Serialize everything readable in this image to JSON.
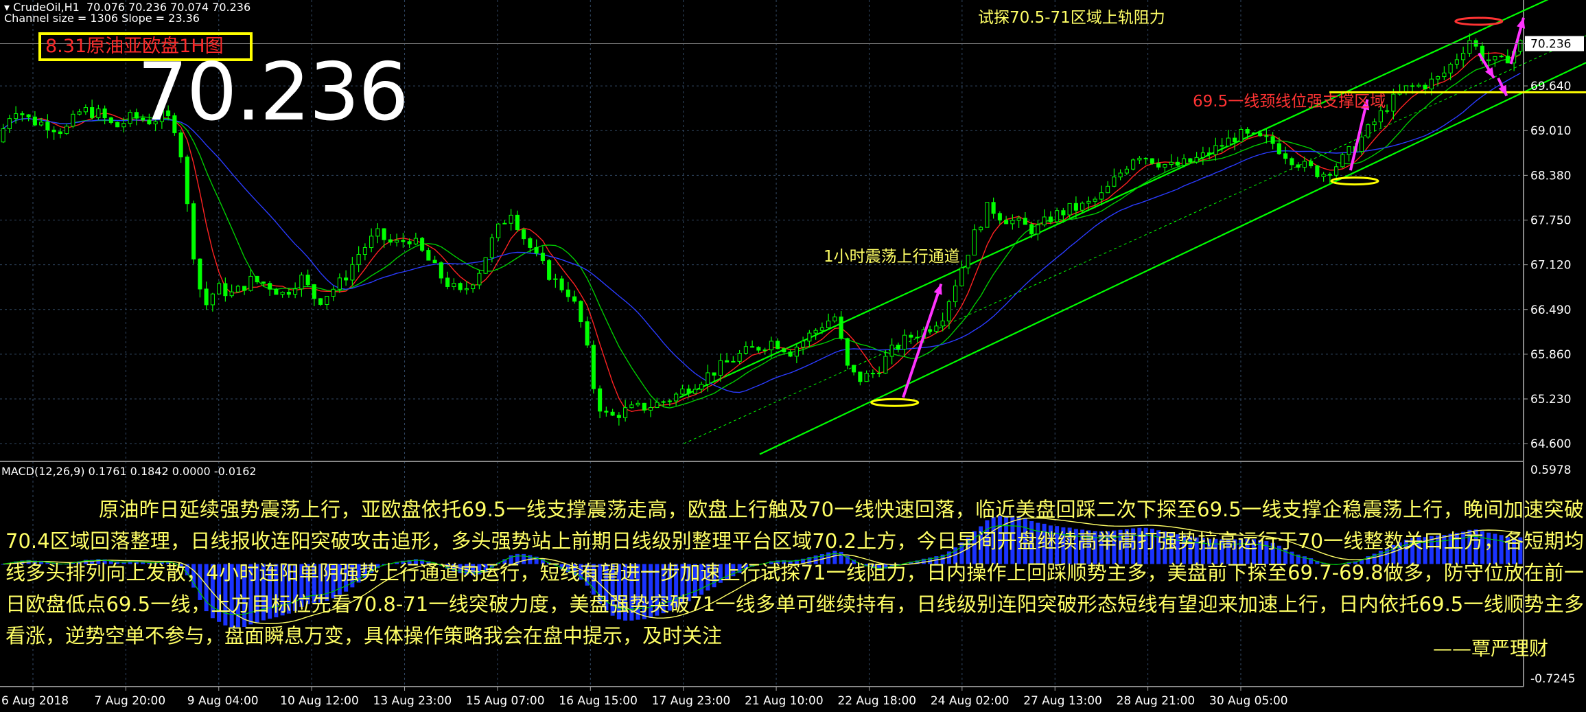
{
  "header": {
    "symbol_line": "CrudeOil,H1  70.076 70.236 70.074 70.236",
    "channel_line": "Channel size = 1306 Slope = 23.36"
  },
  "title_box": "8.31原油亚欧盘1H图",
  "big_price": "70.236",
  "annotations": {
    "resistance": "试探70.5-71区域上轨阻力",
    "support": "69.5一线颈线位强支撑区域",
    "channel": "1小时震荡上行通道"
  },
  "macd_label": "MACD(12,26,9) 0.1761 0.1842 0.0000 -0.0162",
  "commentary": "原油昨日延续强势震荡上行，亚欧盘依托69.5一线支撑震荡走高，欧盘上行触及70一线快速回落，临近美盘回踩二次下探至69.5一线支撑企稳震荡上行，晚间加速突破70.4区域回落整理，日线报收连阳突破攻击追形，多头强势站上前期日线级别整理平台区域70.2上方，今日早间开盘继续高举高打强势拉高运行于70一线整数关口上方，各短期均线多头排列向上发散，4小时连阳单阴强势上行通道内运行，短线有望进一步加速上行试探71一线阻力，日内操作上回踩顺势主多，美盘前下探至69.7-69.8做多，防守位放在前一日欧盘低点69.5一线，上方目标位先看70.8-71一线突破力度，美盘强势突破71一线多单可继续持有，日线级别连阳突破形态短线有望迎来加速上行，日内依托69.5一线顺势主多看涨，逆势空单不参与，盘面瞬息万变，具体操作策略我会在盘中提示，及时关注",
  "signature": "——覃严理财",
  "colors": {
    "bull": "#00ff00",
    "bear": "#00ff00",
    "channel": "#00ff00",
    "arrows": "#ff33ff",
    "ellipse_low": "#ffff00",
    "ellipse_high": "#ff3333",
    "ma_fast": "#ff2222",
    "ma_mid": "#00cc00",
    "ma_slow": "#2a3bff",
    "support_line": "#ffff00",
    "macd_hist": "#1a33ff"
  },
  "chart_data": {
    "type": "candlestick",
    "symbol": "CrudeOil",
    "timeframe": "H1",
    "y_ticks": [
      70.236,
      69.64,
      69.01,
      68.38,
      67.75,
      67.12,
      66.49,
      65.86,
      65.23,
      64.6
    ],
    "ylim": [
      64.35,
      70.85
    ],
    "x_ticks": [
      "6 Aug 2018",
      "7 Aug 20:00",
      "9 Aug 04:00",
      "10 Aug 12:00",
      "13 Aug 23:00",
      "15 Aug 07:00",
      "16 Aug 15:00",
      "17 Aug 23:00",
      "21 Aug 10:00",
      "22 Aug 18:00",
      "24 Aug 02:00",
      "27 Aug 13:00",
      "28 Aug 21:00",
      "30 Aug 05:00"
    ],
    "last_price": 70.236,
    "price_path": [
      [
        0,
        68.85
      ],
      [
        20,
        69.35
      ],
      [
        40,
        69.15
      ],
      [
        60,
        69.1
      ],
      [
        80,
        69.0
      ],
      [
        100,
        69.3
      ],
      [
        120,
        69.25
      ],
      [
        140,
        69.05
      ],
      [
        160,
        69.2
      ],
      [
        180,
        69.15
      ],
      [
        200,
        69.22
      ],
      [
        215,
        69.0
      ],
      [
        230,
        67.5
      ],
      [
        245,
        66.5
      ],
      [
        260,
        66.8
      ],
      [
        280,
        66.7
      ],
      [
        300,
        66.9
      ],
      [
        320,
        66.85
      ],
      [
        340,
        66.7
      ],
      [
        360,
        66.95
      ],
      [
        380,
        66.6
      ],
      [
        395,
        66.75
      ],
      [
        410,
        66.9
      ],
      [
        430,
        67.3
      ],
      [
        450,
        67.55
      ],
      [
        470,
        67.4
      ],
      [
        490,
        67.5
      ],
      [
        510,
        67.2
      ],
      [
        530,
        66.9
      ],
      [
        550,
        66.7
      ],
      [
        570,
        67.0
      ],
      [
        590,
        67.55
      ],
      [
        610,
        67.9
      ],
      [
        620,
        67.6
      ],
      [
        640,
        67.2
      ],
      [
        660,
        66.9
      ],
      [
        680,
        66.7
      ],
      [
        695,
        66.2
      ],
      [
        710,
        65.2
      ],
      [
        725,
        64.95
      ],
      [
        740,
        65.05
      ],
      [
        760,
        65.1
      ],
      [
        780,
        65.15
      ],
      [
        800,
        65.25
      ],
      [
        820,
        65.4
      ],
      [
        840,
        65.55
      ],
      [
        860,
        65.7
      ],
      [
        880,
        65.85
      ],
      [
        900,
        65.95
      ],
      [
        920,
        66.05
      ],
      [
        940,
        65.9
      ],
      [
        960,
        66.1
      ],
      [
        980,
        66.3
      ],
      [
        995,
        66.4
      ],
      [
        1005,
        65.7
      ],
      [
        1020,
        65.5
      ],
      [
        1040,
        65.6
      ],
      [
        1060,
        65.9
      ],
      [
        1080,
        66.1
      ],
      [
        1100,
        66.2
      ],
      [
        1120,
        66.4
      ],
      [
        1140,
        67.0
      ],
      [
        1160,
        67.6
      ],
      [
        1175,
        67.95
      ],
      [
        1190,
        67.8
      ],
      [
        1210,
        67.7
      ],
      [
        1230,
        67.6
      ],
      [
        1250,
        67.8
      ],
      [
        1270,
        67.9
      ],
      [
        1290,
        67.95
      ],
      [
        1310,
        68.1
      ],
      [
        1330,
        68.4
      ],
      [
        1350,
        68.7
      ],
      [
        1370,
        68.6
      ],
      [
        1390,
        68.5
      ],
      [
        1410,
        68.55
      ],
      [
        1430,
        68.65
      ],
      [
        1450,
        68.8
      ],
      [
        1470,
        68.95
      ],
      [
        1490,
        68.9
      ],
      [
        1510,
        68.85
      ],
      [
        1530,
        68.65
      ],
      [
        1550,
        68.5
      ],
      [
        1570,
        68.4
      ],
      [
        1590,
        68.55
      ],
      [
        1610,
        68.8
      ],
      [
        1630,
        69.1
      ],
      [
        1650,
        69.4
      ],
      [
        1670,
        69.6
      ],
      [
        1690,
        69.65
      ],
      [
        1710,
        69.75
      ],
      [
        1730,
        70.05
      ],
      [
        1745,
        70.3
      ],
      [
        1760,
        70.05
      ],
      [
        1780,
        69.95
      ],
      [
        1795,
        70.1
      ],
      [
        1805,
        70.236
      ]
    ],
    "macd": {
      "name": "MACD(12,26,9)",
      "values": [
        0.1761,
        0.1842,
        0.0,
        -0.0162
      ],
      "ylim": [
        -0.7245,
        0.5978
      ],
      "y_ticks": [
        0.5978,
        -0.7245
      ]
    }
  }
}
